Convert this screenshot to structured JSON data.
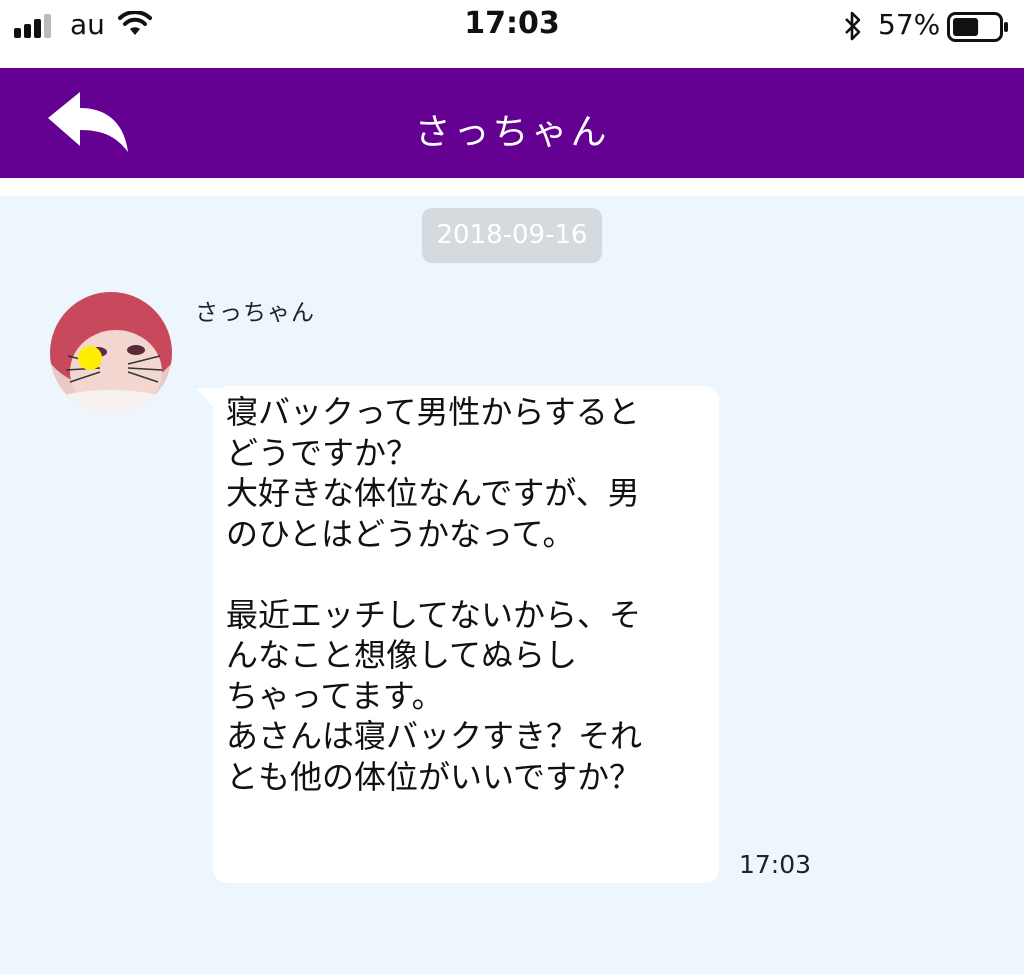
{
  "status_bar": {
    "carrier": "au",
    "time": "17:03",
    "battery_percent": "57%",
    "battery_level": 0.57,
    "signal_bars": 4,
    "icons": [
      "signal-icon",
      "wifi-icon",
      "bluetooth-icon",
      "battery-icon"
    ]
  },
  "header": {
    "back_icon": "back-arrow-icon",
    "title": "さっちゃん",
    "background_color": "#640092"
  },
  "chat": {
    "date_label": "2018-09-16",
    "messages": [
      {
        "sender": "さっちゃん",
        "avatar_icon": "avatar-image",
        "text": "寝バックって男性からすると\nどうですか？\n大好きな体位なんですが、男\nのひとはどうかなって。\n\n最近エッチしてないから、そ\nんなこと想像してぬらし\nちゃってます。\nあさんは寝バックすき？それ\nとも他の体位がいいですか？",
        "time": "17:03"
      }
    ]
  },
  "colors": {
    "chat_background": "#eef6fd",
    "bubble": "#ffffff",
    "date_chip": "#d5dade"
  }
}
